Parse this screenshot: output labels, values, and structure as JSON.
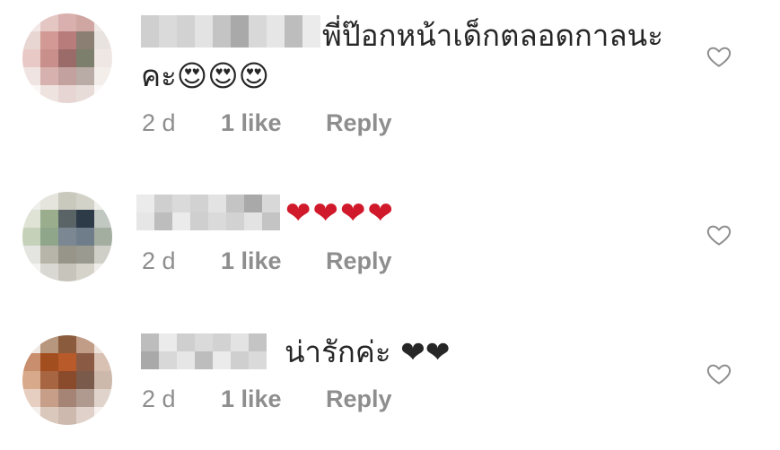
{
  "comments": [
    {
      "text_line1": "พี่ป๊อกหน้าเด็กตลอดกาลนะ",
      "text_line2": "คะ😍😍😍",
      "time": "2 d",
      "likes": "1 like",
      "reply_label": "Reply",
      "like_icon": "heart-outline-icon"
    },
    {
      "text_line1": "❤❤❤❤",
      "time": "2 d",
      "likes": "1 like",
      "reply_label": "Reply",
      "like_icon": "heart-outline-icon"
    },
    {
      "text_line1": "น่ารักค่ะ ❤❤",
      "time": "2 d",
      "likes": "1 like",
      "reply_label": "Reply",
      "like_icon": "heart-outline-icon"
    }
  ],
  "colors": {
    "text": "#262626",
    "meta": "#8e8e8e",
    "heart": "#e0252c",
    "avatar1": [
      "#f3e7e7",
      "#e4c6c3",
      "#d9b0ad",
      "#cfa6a2",
      "#efe9e6",
      "#e8d6d3",
      "#d39a95",
      "#b87c7a",
      "#8b7f73",
      "#e9e3df",
      "#e9c9c6",
      "#c98f8b",
      "#9b6b6a",
      "#7c7f6c",
      "#efe7e3",
      "#efe4e1",
      "#d6b1ad",
      "#c2a19e",
      "#b9aba5",
      "#f4eeeb",
      "#fbf7f6",
      "#efe3e0",
      "#e6d5d2",
      "#e8dcd9",
      "#fbf8f7"
    ],
    "avatar2": [
      "#eeeeea",
      "#e5e5de",
      "#c9c9bd",
      "#d2d2c8",
      "#eeeeea",
      "#dfe3d6",
      "#9aae8e",
      "#5a6467",
      "#2d3a47",
      "#c1c7c1",
      "#c5d1b8",
      "#8fa68b",
      "#7b8793",
      "#6f7d8a",
      "#a3aea1",
      "#e4e4e0",
      "#b7b5aa",
      "#979489",
      "#9b9a90",
      "#cfcec7",
      "#f4f4f2",
      "#d9d8d2",
      "#c7c4bb",
      "#d6d3cb",
      "#efeeea"
    ],
    "avatar3": [
      "#efe7e1",
      "#b7977d",
      "#8a5b3d",
      "#c19c86",
      "#efe4dc",
      "#c88e6d",
      "#a34e1f",
      "#b85a2a",
      "#8a5a45",
      "#d8c0b2",
      "#d8a98a",
      "#a86542",
      "#8a4a2c",
      "#7a5a4a",
      "#cdb8ac",
      "#e6cfc0",
      "#c79f89",
      "#a58475",
      "#b09a90",
      "#e0d3cc",
      "#f5efeb",
      "#dbc8bd",
      "#cdb9ae",
      "#e0d2ca",
      "#f7f2ef"
    ],
    "username": [
      "#cfcfcf",
      "#e3e3e3",
      "#d8d8d8",
      "#ebebeb",
      "#d2d2d2",
      "#a9a9a9",
      "#bdbdbd",
      "#dadada",
      "#c4c4c4",
      "#e6e6e6"
    ]
  }
}
